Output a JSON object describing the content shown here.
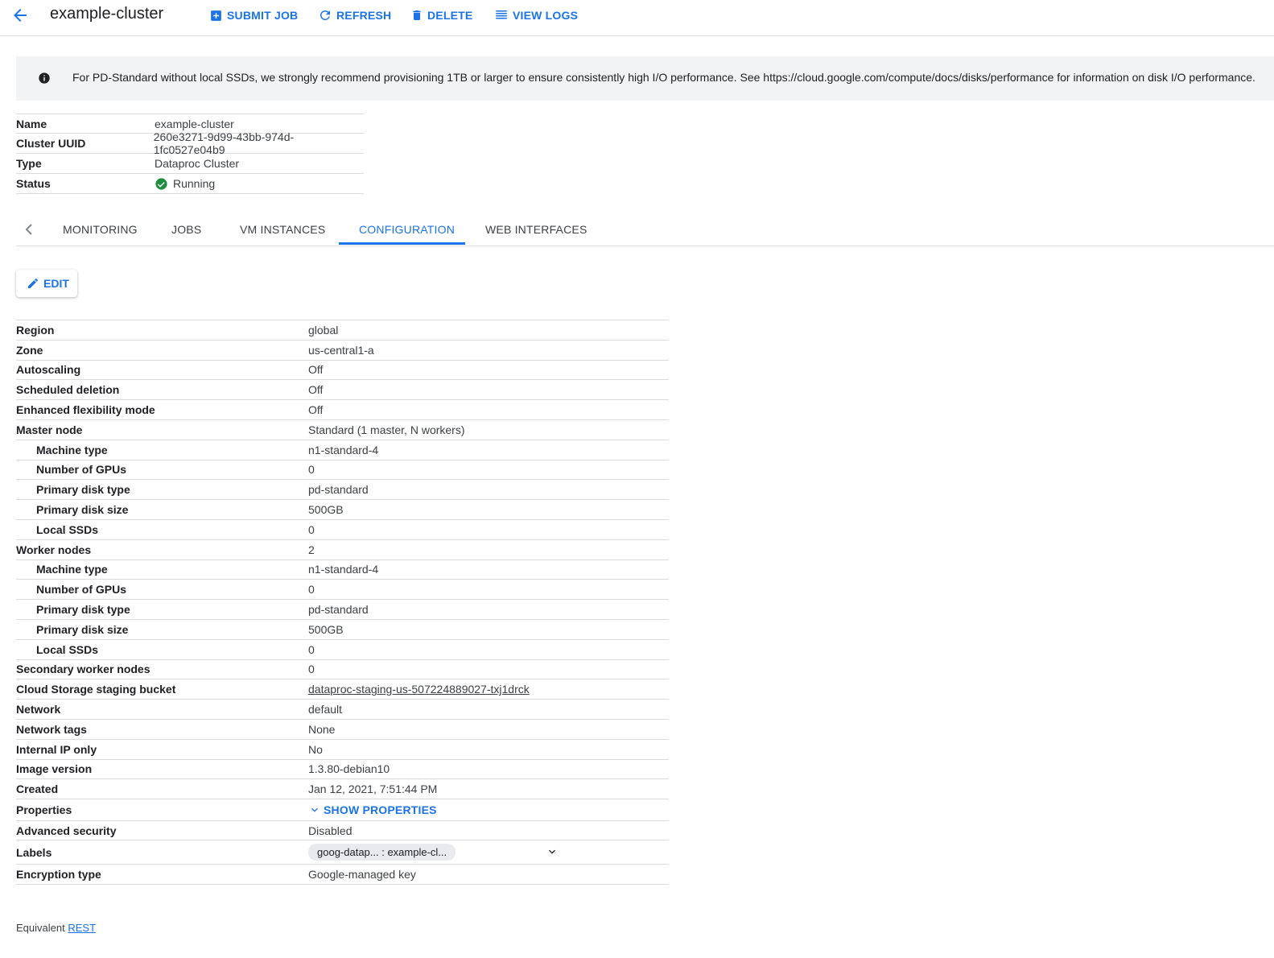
{
  "header": {
    "title": "example-cluster",
    "actions": {
      "submit_job": "SUBMIT JOB",
      "refresh": "REFRESH",
      "delete": "DELETE",
      "view_logs": "VIEW LOGS"
    }
  },
  "banner": {
    "text": "For PD-Standard without local SSDs, we strongly recommend provisioning 1TB or larger to ensure consistently high I/O performance. See https://cloud.google.com/compute/docs/disks/performance for information on disk I/O performance."
  },
  "summary": {
    "name_label": "Name",
    "name_value": "example-cluster",
    "uuid_label": "Cluster UUID",
    "uuid_value": "260e3271-9d99-43bb-974d-1fc0527e04b9",
    "type_label": "Type",
    "type_value": "Dataproc Cluster",
    "status_label": "Status",
    "status_value": "Running"
  },
  "tabs": {
    "monitoring": "MONITORING",
    "jobs": "JOBS",
    "vm_instances": "VM INSTANCES",
    "configuration": "CONFIGURATION",
    "web_interfaces": "WEB INTERFACES"
  },
  "edit_label": "EDIT",
  "config": {
    "region": {
      "k": "Region",
      "v": "global"
    },
    "zone": {
      "k": "Zone",
      "v": "us-central1-a"
    },
    "autoscaling": {
      "k": "Autoscaling",
      "v": "Off"
    },
    "scheduled_deletion": {
      "k": "Scheduled deletion",
      "v": "Off"
    },
    "efm": {
      "k": "Enhanced flexibility mode",
      "v": "Off"
    },
    "master_node": {
      "k": "Master node",
      "v": "Standard (1 master, N workers)"
    },
    "m_machine_type": {
      "k": "Machine type",
      "v": "n1-standard-4"
    },
    "m_gpus": {
      "k": "Number of GPUs",
      "v": "0"
    },
    "m_disk_type": {
      "k": "Primary disk type",
      "v": "pd-standard"
    },
    "m_disk_size": {
      "k": "Primary disk size",
      "v": "500GB"
    },
    "m_local_ssds": {
      "k": "Local SSDs",
      "v": "0"
    },
    "worker_nodes": {
      "k": "Worker nodes",
      "v": "2"
    },
    "w_machine_type": {
      "k": "Machine type",
      "v": "n1-standard-4"
    },
    "w_gpus": {
      "k": "Number of GPUs",
      "v": "0"
    },
    "w_disk_type": {
      "k": "Primary disk type",
      "v": "pd-standard"
    },
    "w_disk_size": {
      "k": "Primary disk size",
      "v": "500GB"
    },
    "w_local_ssds": {
      "k": "Local SSDs",
      "v": "0"
    },
    "secondary_workers": {
      "k": "Secondary worker nodes",
      "v": "0"
    },
    "staging_bucket": {
      "k": "Cloud Storage staging bucket",
      "v": "dataproc-staging-us-507224889027-txj1drck"
    },
    "network": {
      "k": "Network",
      "v": "default"
    },
    "network_tags": {
      "k": "Network tags",
      "v": "None"
    },
    "internal_ip": {
      "k": "Internal IP only",
      "v": "No"
    },
    "image_version": {
      "k": "Image version",
      "v": "1.3.80-debian10"
    },
    "created": {
      "k": "Created",
      "v": "Jan 12, 2021, 7:51:44 PM"
    },
    "properties": {
      "k": "Properties",
      "v": "SHOW PROPERTIES"
    },
    "advanced_security": {
      "k": "Advanced security",
      "v": "Disabled"
    },
    "labels": {
      "k": "Labels",
      "v": "goog-datap... : example-cl..."
    },
    "encryption": {
      "k": "Encryption type",
      "v": "Google-managed key"
    }
  },
  "footer": {
    "prefix": "Equivalent",
    "link": "REST"
  },
  "colors": {
    "accent": "#1a73e8",
    "success": "#1e8e3e",
    "banner_bg": "#f1f3f4"
  }
}
